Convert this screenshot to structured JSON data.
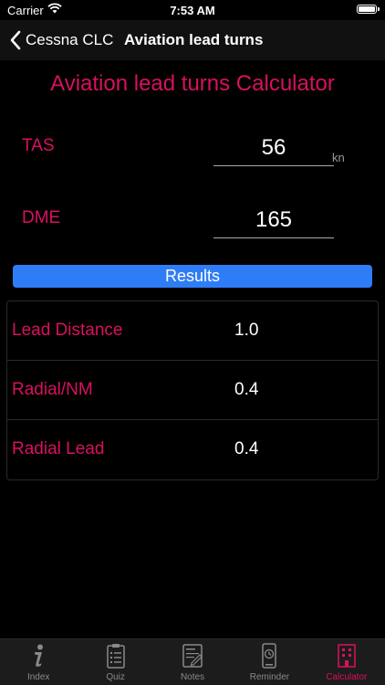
{
  "status_bar": {
    "carrier": "Carrier",
    "time": "7:53 AM"
  },
  "nav": {
    "back_label": "Cessna CLC",
    "title": "Aviation lead turns"
  },
  "page_title": "Aviation lead turns Calculator",
  "fields": {
    "tas": {
      "label": "TAS",
      "value": "56",
      "unit": "kn"
    },
    "dme": {
      "label": "DME",
      "value": "165"
    }
  },
  "results_button": "Results",
  "results": [
    {
      "label": "Lead Distance",
      "value": "1.0"
    },
    {
      "label": "Radial/NM",
      "value": "0.4"
    },
    {
      "label": "Radial Lead",
      "value": "0.4"
    }
  ],
  "tabs": [
    {
      "label": "Index",
      "icon": "info-icon",
      "active": false
    },
    {
      "label": "Quiz",
      "icon": "clipboard-icon",
      "active": false
    },
    {
      "label": "Notes",
      "icon": "notes-icon",
      "active": false
    },
    {
      "label": "Reminder",
      "icon": "phone-clock-icon",
      "active": false
    },
    {
      "label": "Calculator",
      "icon": "building-icon",
      "active": true
    }
  ],
  "colors": {
    "accent": "#d9105f",
    "button": "#2f7df6",
    "background": "#000000"
  }
}
